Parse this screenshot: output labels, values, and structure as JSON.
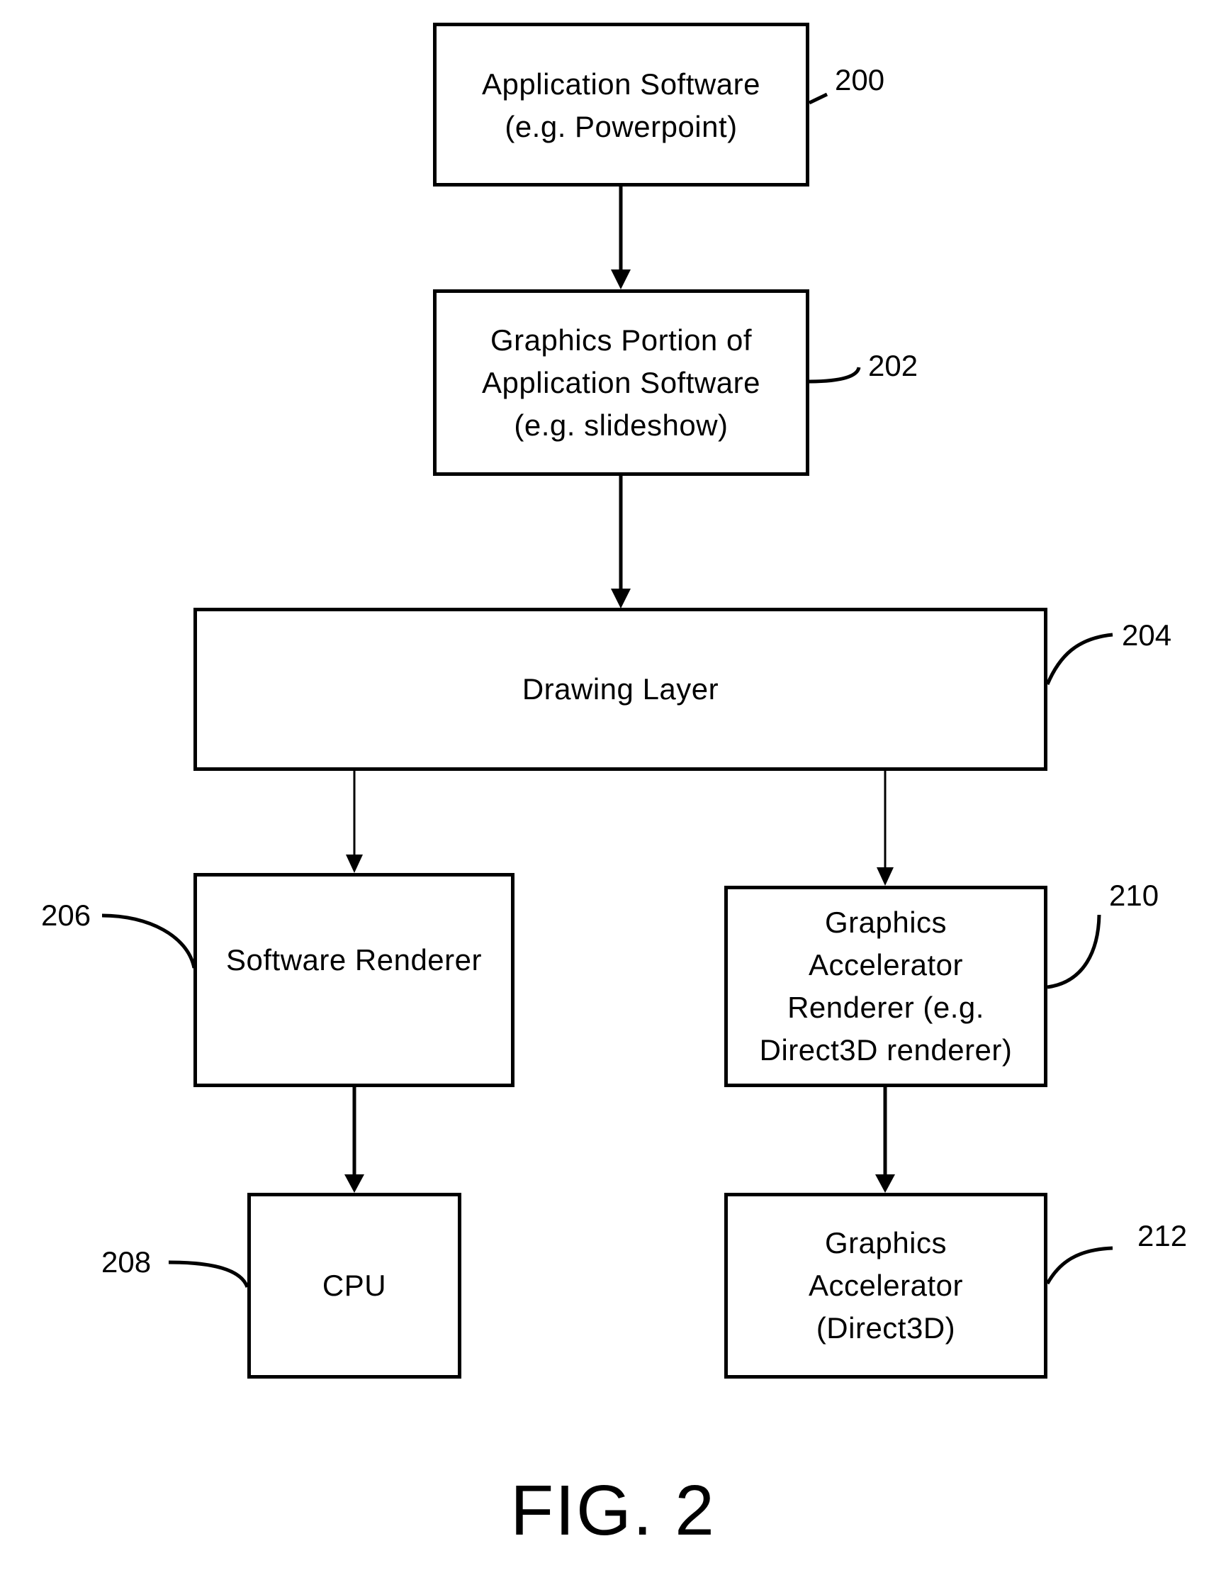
{
  "figure": {
    "title": "FIG. 2",
    "nodes": [
      {
        "id": "200",
        "ref": "200",
        "label": "Application Software\n(e.g. Powerpoint)"
      },
      {
        "id": "202",
        "ref": "202",
        "label": "Graphics Portion of\nApplication Software\n(e.g. slideshow)"
      },
      {
        "id": "204",
        "ref": "204",
        "label": "Drawing Layer"
      },
      {
        "id": "206",
        "ref": "206",
        "label": "Software Renderer"
      },
      {
        "id": "208",
        "ref": "208",
        "label": "CPU"
      },
      {
        "id": "210",
        "ref": "210",
        "label": "Graphics\nAccelerator\nRenderer (e.g.\nDirect3D renderer)"
      },
      {
        "id": "212",
        "ref": "212",
        "label": "Graphics\nAccelerator\n(Direct3D)"
      }
    ],
    "edges": [
      {
        "from": "200",
        "to": "202"
      },
      {
        "from": "202",
        "to": "204"
      },
      {
        "from": "204",
        "to": "206"
      },
      {
        "from": "204",
        "to": "210"
      },
      {
        "from": "206",
        "to": "208"
      },
      {
        "from": "210",
        "to": "212"
      }
    ]
  }
}
